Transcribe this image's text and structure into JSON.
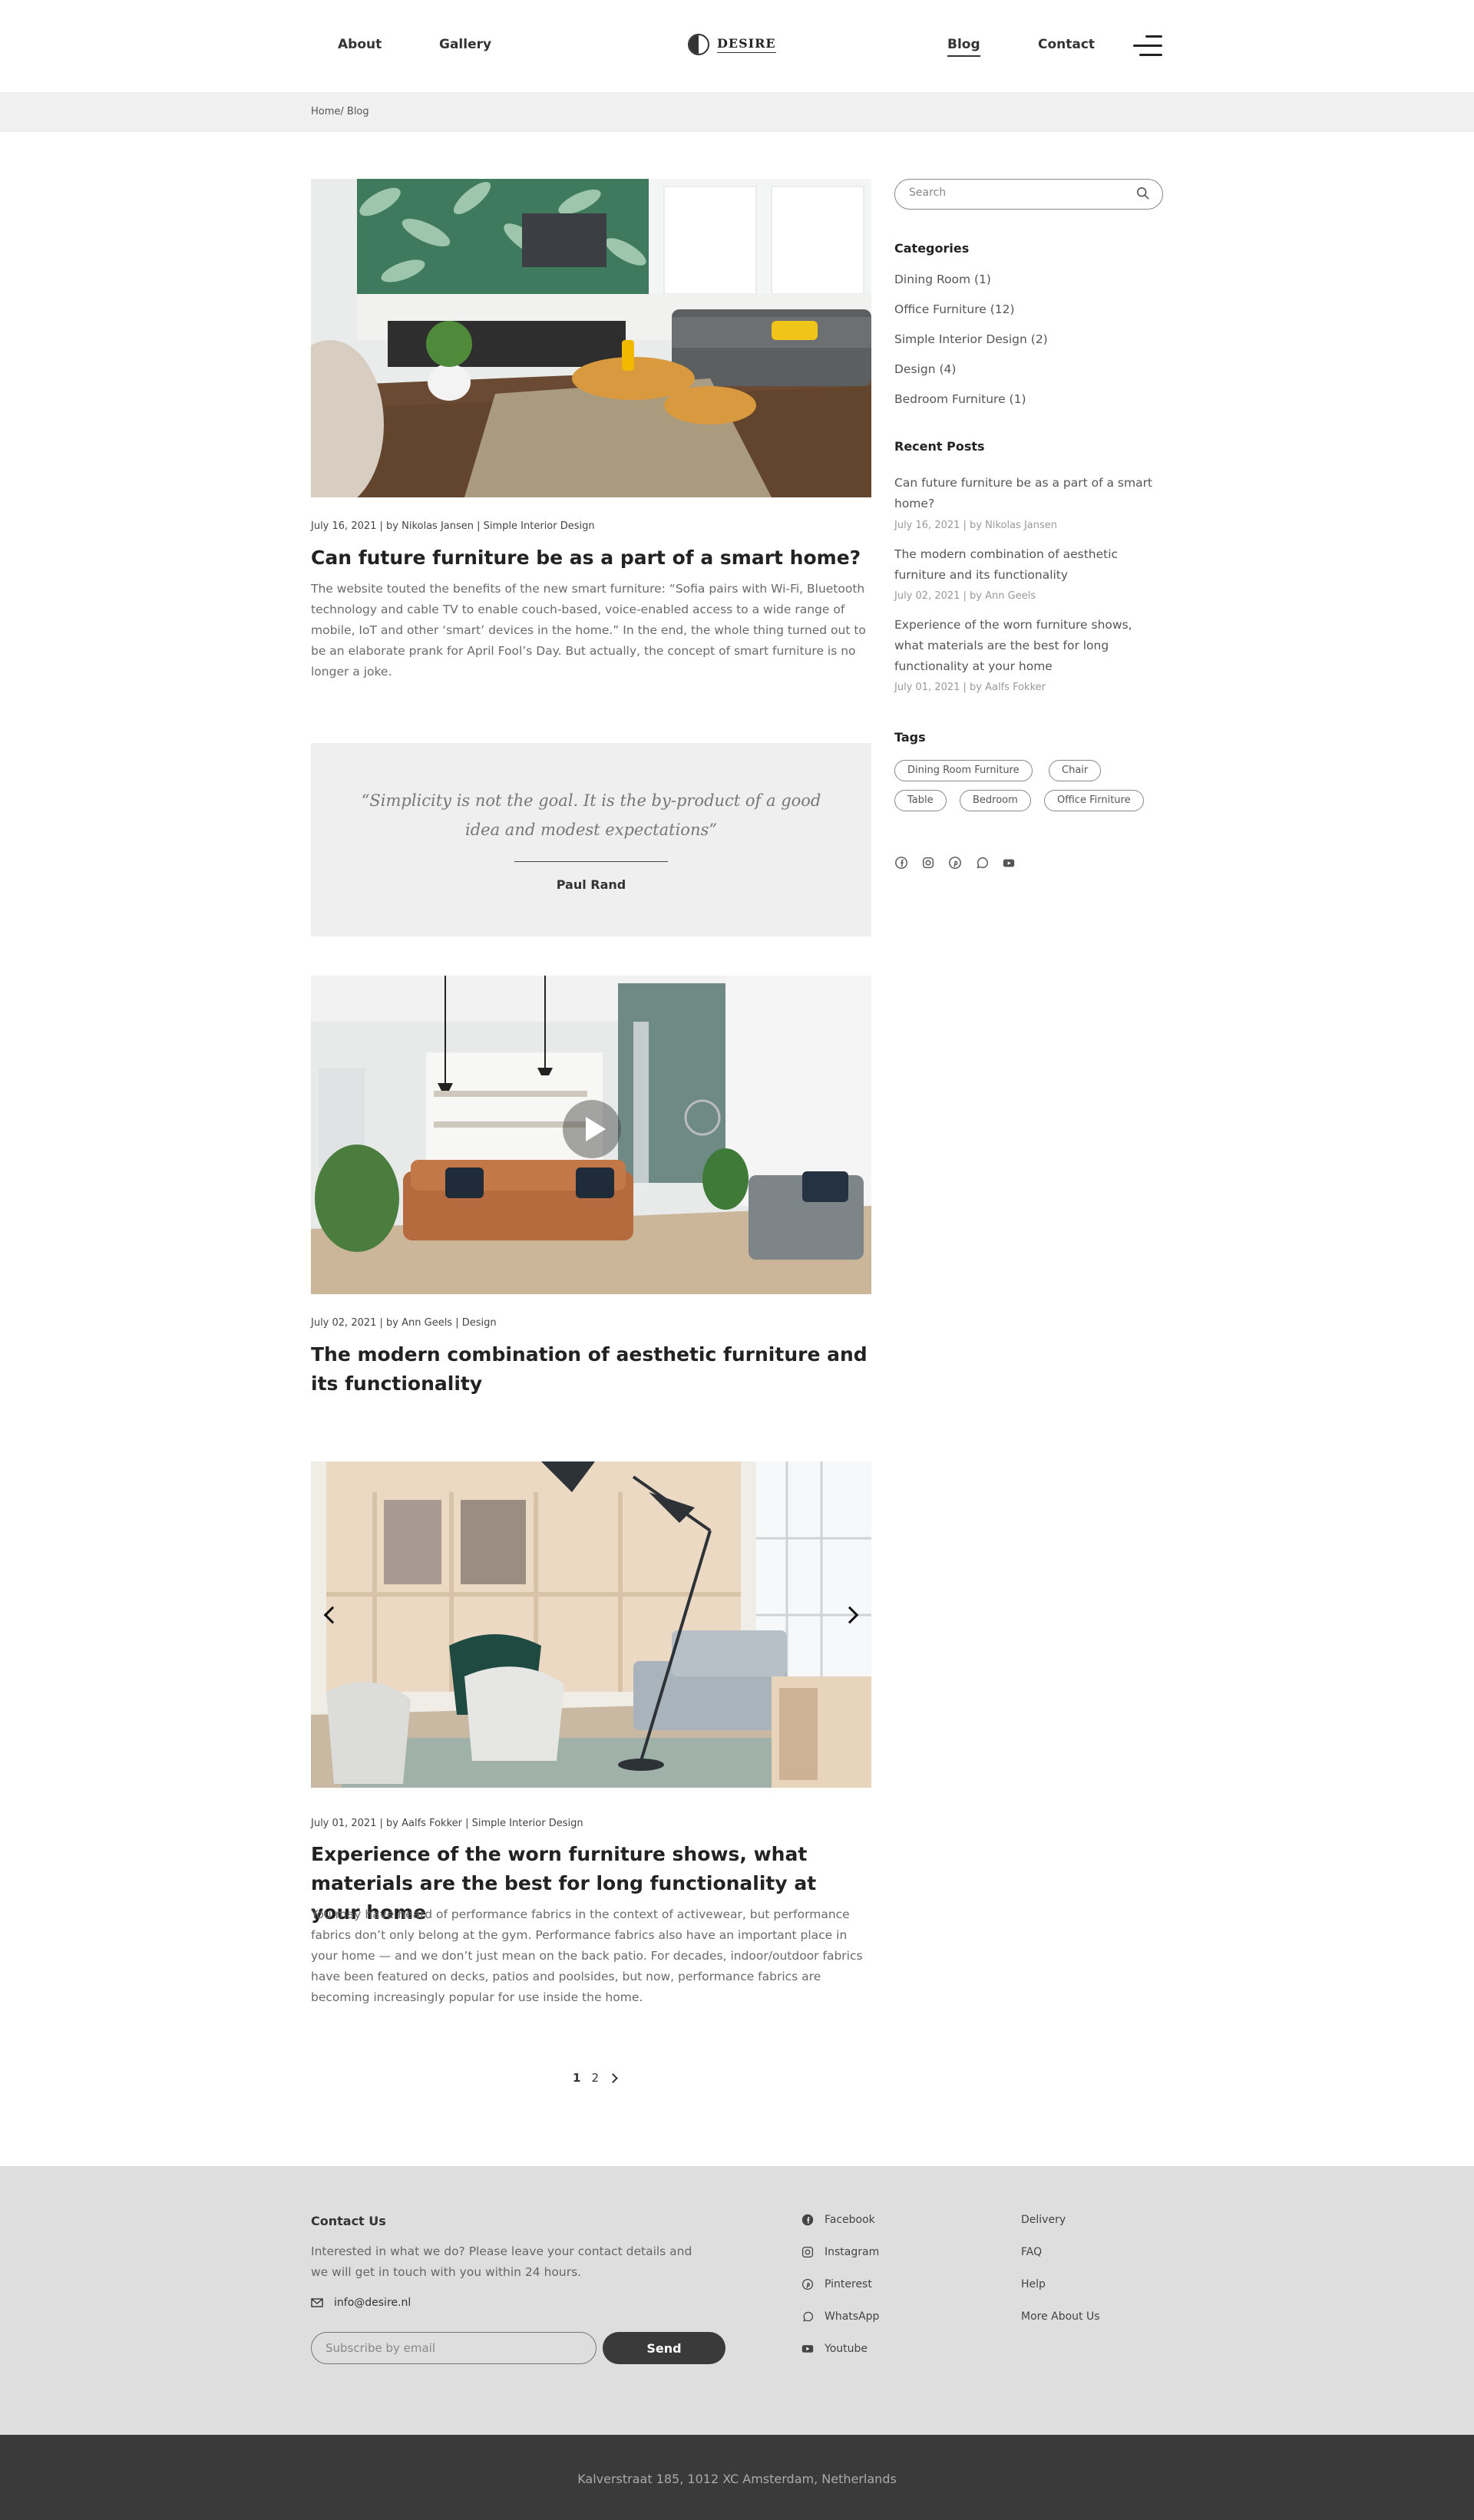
{
  "nav": {
    "about": "About",
    "gallery": "Gallery",
    "logo_text": "DESIRE",
    "blog": "Blog",
    "contact": "Contact"
  },
  "breadcrumb": "Home/ Blog",
  "posts": [
    {
      "meta": "July 16, 2021 | by Nikolas Jansen | Simple Interior Design",
      "title": "Can future furniture be as a part of a smart home?",
      "excerpt": "The website touted the benefits of the new smart furniture: “Sofia pairs with Wi-Fi, Bluetooth technology and cable TV to enable couch-based, voice-enabled access to a wide range of mobile, IoT and other ‘smart’ devices in the home.” In the end, the whole thing turned out to be an elaborate prank for April Fool’s Day. But actually, the concept of smart furniture is no longer a joke."
    },
    {
      "meta": "July 02, 2021 | by Ann Geels | Design",
      "title": "The modern combination of aesthetic furniture and its functionality"
    },
    {
      "meta": "July 01, 2021 | by Aalfs Fokker | Simple Interior Design",
      "title": "Experience of the worn furniture shows, what materials are the best for long functionality at your home",
      "excerpt": "You may have heard of performance fabrics in the context of activewear, but performance fabrics don’t only belong at the gym. Performance fabrics also have an important place in your home — and we don’t just mean on the back patio. For decades, indoor/outdoor fabrics have been featured on decks, patios and poolsides, but now, performance fabrics are becoming increasingly popular for use inside the home."
    }
  ],
  "quote": {
    "text": "“Simplicity is not the goal. It is the by-product of a good idea and modest expectations”",
    "author": "Paul Rand"
  },
  "pagination": {
    "page1": "1",
    "page2": "2"
  },
  "sidebar": {
    "search_placeholder": "Search",
    "categories_heading": "Categories",
    "categories": [
      "Dining Room (1)",
      "Office Furniture (12)",
      "Simple Interior Design (2)",
      "Design (4)",
      "Bedroom Furniture (1)"
    ],
    "recent_heading": "Recent Posts",
    "recent": [
      {
        "title": "Can future furniture be as a part of a smart home?",
        "meta": "July 16, 2021  |  by Nikolas Jansen"
      },
      {
        "title": "The modern combination of aesthetic furniture and its functionality",
        "meta": "July 02, 2021  |  by Ann Geels"
      },
      {
        "title": "Experience of the worn furniture shows, what materials are the best for long functionality at your home",
        "meta": "July 01, 2021  |  by Aalfs Fokker"
      }
    ],
    "tags_heading": "Tags",
    "tags": [
      "Dining Room Furniture",
      "Chair",
      "Table",
      "Bedroom",
      "Office Firniture"
    ],
    "social_icons": [
      "facebook-icon",
      "instagram-icon",
      "pinterest-icon",
      "whatsapp-icon",
      "youtube-icon"
    ]
  },
  "footer": {
    "contact_heading": "Contact Us",
    "contact_text": "Interested in what we do? Please leave your contact details and we will get in touch with you within 24 hours.",
    "email": "info@desire.nl",
    "subscribe_placeholder": "Subscribe by email",
    "send_label": "Send",
    "social": [
      "Facebook",
      "Instagram",
      "Pinterest",
      "WhatsApp",
      "Youtube"
    ],
    "links": [
      "Delivery",
      "FAQ",
      "Help",
      "More About Us"
    ],
    "address": "Kalverstraat 185, 1012 XC Amsterdam, Netherlands"
  },
  "colors": {
    "footer_bg": "#dedede",
    "bottom_bar_bg": "#3a3a3a",
    "band_bg": "#f0f0f0",
    "text_dark": "#222222"
  }
}
